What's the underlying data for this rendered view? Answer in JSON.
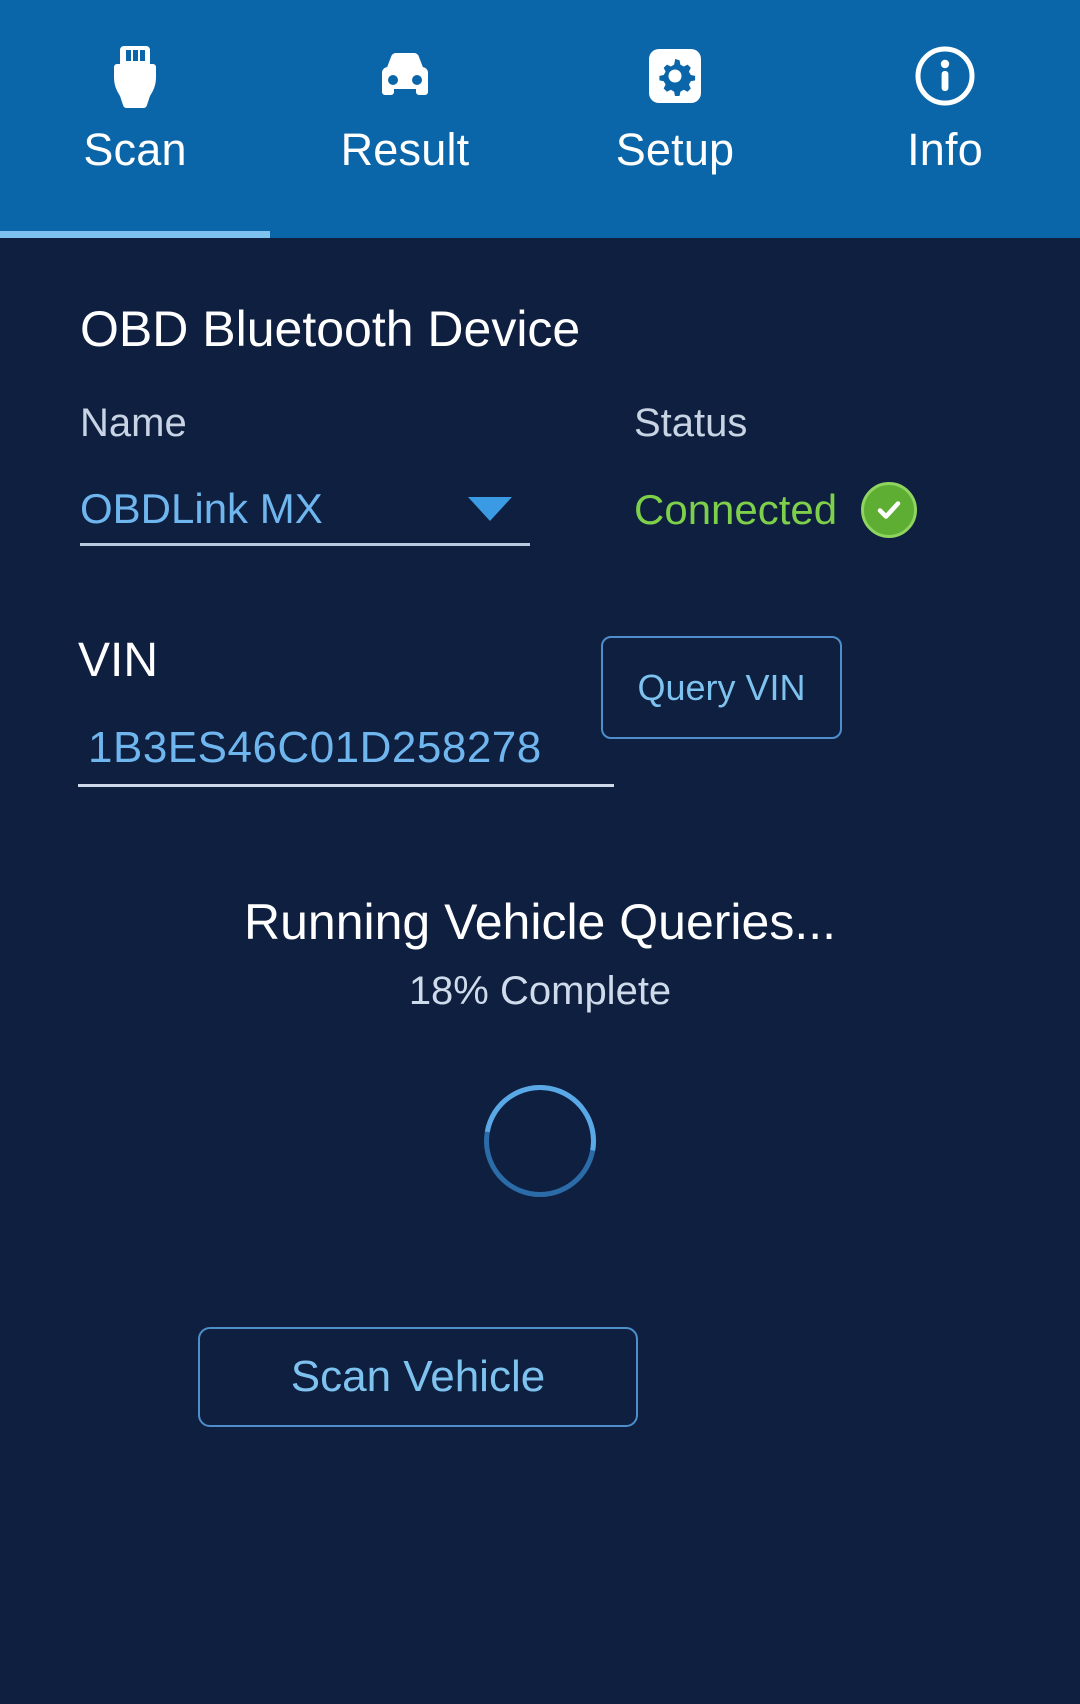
{
  "theme": {
    "tabbar_bg": "#0a66a8",
    "page_bg": "#0e1f3f",
    "accent_blue": "#6fb6ef",
    "status_green": "#7ed04a",
    "active_tab_underline": "#7ec2ef"
  },
  "tabs": [
    {
      "label": "Scan",
      "icon": "obd-connector-icon",
      "active": true
    },
    {
      "label": "Result",
      "icon": "car-front-icon",
      "active": false
    },
    {
      "label": "Setup",
      "icon": "gear-icon",
      "active": false
    },
    {
      "label": "Info",
      "icon": "info-circle-icon",
      "active": false
    }
  ],
  "device_section": {
    "title": "OBD Bluetooth Device",
    "name_label": "Name",
    "name_value": "OBDLink MX",
    "name_options": [
      "OBDLink MX"
    ],
    "status_label": "Status",
    "status_value": "Connected",
    "status_icon": "check-circle-icon"
  },
  "vin_section": {
    "label": "VIN",
    "value": "1B3ES46C01D258278",
    "placeholder": "VIN",
    "query_button": "Query VIN"
  },
  "progress": {
    "title": "Running Vehicle Queries...",
    "percent": 18,
    "subtitle": "18% Complete",
    "spinner": "loading-spinner-icon"
  },
  "actions": {
    "scan_button": "Scan Vehicle"
  }
}
